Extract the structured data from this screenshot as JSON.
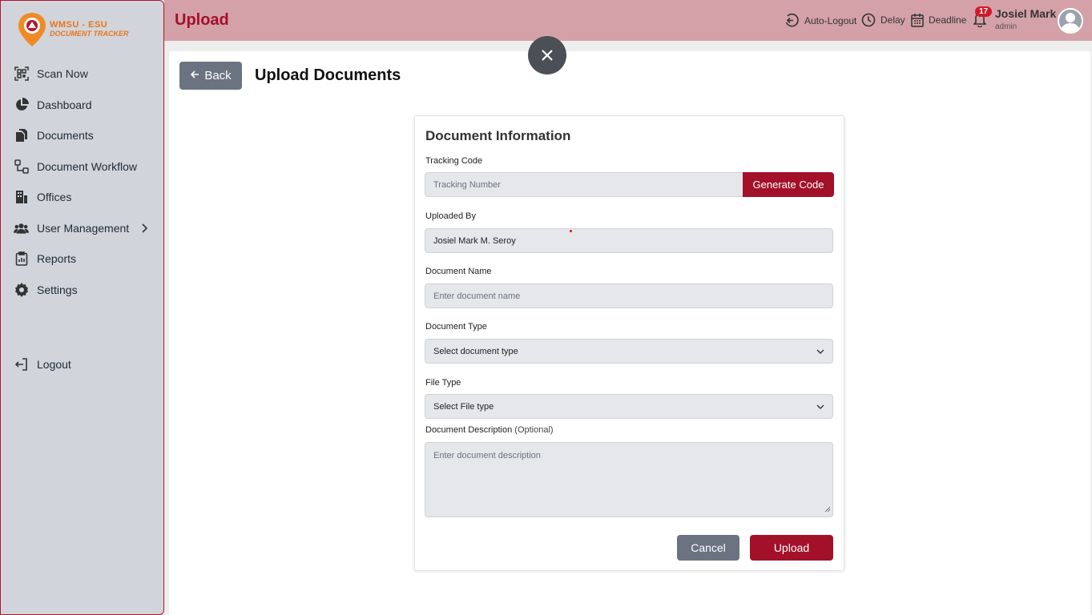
{
  "app": {
    "logo_line1": "WMSU - ESU",
    "logo_line2": "DOCUMENT TRACKER"
  },
  "sidebar": {
    "items": [
      {
        "label": "Scan Now",
        "icon": "qr-scan-icon"
      },
      {
        "label": "Dashboard",
        "icon": "pie-chart-icon"
      },
      {
        "label": "Documents",
        "icon": "documents-icon"
      },
      {
        "label": "Document Workflow",
        "icon": "workflow-icon"
      },
      {
        "label": "Offices",
        "icon": "building-icon"
      },
      {
        "label": "User Management",
        "icon": "users-icon"
      },
      {
        "label": "Reports",
        "icon": "clipboard-icon"
      },
      {
        "label": "Settings",
        "icon": "gear-icon"
      }
    ],
    "logout_label": "Logout"
  },
  "header": {
    "title": "Upload",
    "auto_logout": "Auto-Logout",
    "delay": "Delay",
    "deadline": "Deadline",
    "notification_count": "17",
    "user_name": "Josiel Mark",
    "user_role": "admin"
  },
  "main": {
    "back_label": "Back",
    "page_title": "Upload Documents"
  },
  "form": {
    "title": "Document Information",
    "tracking_label": "Tracking Code",
    "tracking_placeholder": "Tracking Number",
    "generate_label": "Generate Code",
    "uploaded_by_label": "Uploaded By",
    "uploaded_by_value": "Josiel Mark M. Seroy",
    "doc_name_label": "Document Name",
    "doc_name_placeholder": "Enter document name",
    "doc_type_label": "Document Type",
    "doc_type_value": "Select document type",
    "file_type_label": "File Type",
    "file_type_value": "Select File type",
    "desc_label": "Document Description",
    "desc_optional": "(Optional)",
    "desc_placeholder": "Enter document description",
    "cancel_label": "Cancel",
    "upload_label": "Upload"
  },
  "colors": {
    "accent": "#a3102a",
    "header_bg": "#d4a1a8",
    "sidebar_bg": "#d1d5db"
  }
}
